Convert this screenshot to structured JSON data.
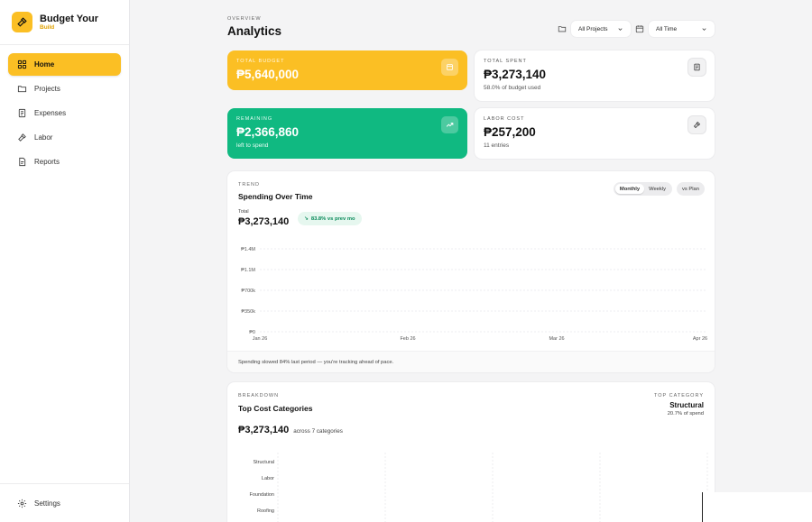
{
  "brand": {
    "title": "Budget Your",
    "subtitle": "Build",
    "accent": "#fbbf24"
  },
  "sidebar": {
    "items": [
      {
        "label": "Home",
        "icon": "grid-icon",
        "active": true
      },
      {
        "label": "Projects",
        "icon": "folder-icon",
        "active": false
      },
      {
        "label": "Expenses",
        "icon": "receipt-icon",
        "active": false
      },
      {
        "label": "Labor",
        "icon": "hammer-icon",
        "active": false
      },
      {
        "label": "Reports",
        "icon": "document-icon",
        "active": false
      }
    ],
    "footer": {
      "label": "Settings",
      "icon": "gear-icon"
    }
  },
  "header": {
    "eyebrow": "OVERVIEW",
    "title": "Analytics",
    "project_filter": "All Projects",
    "time_filter": "All Time"
  },
  "stats": {
    "total_budget": {
      "label": "TOTAL BUDGET",
      "value": "₱5,640,000",
      "color": "#fbbf24"
    },
    "total_spent": {
      "label": "TOTAL SPENT",
      "value": "₱3,273,140",
      "sub": "58.0% of budget used"
    },
    "remaining": {
      "label": "REMAINING",
      "value": "₱2,366,860",
      "sub": "left to spend",
      "color": "#10b981"
    },
    "labor_cost": {
      "label": "LABOR COST",
      "value": "₱257,200",
      "sub": "11 entries"
    }
  },
  "trend": {
    "eyebrow": "TREND",
    "title": "Spending Over Time",
    "toggle": {
      "monthly": "Monthly",
      "weekly": "Weekly",
      "selected": "Monthly"
    },
    "vs_plan": "vs Plan",
    "total_label": "Total",
    "total_value": "₱3,273,140",
    "change": "83.8% vs prev mo",
    "footer": "Spending slowed 84% last period — you're tracking ahead of pace."
  },
  "breakdown": {
    "eyebrow": "BREAKDOWN",
    "title": "Top Cost Categories",
    "top_label": "TOP CATEGORY",
    "top_name": "Structural",
    "top_pct": "20.7% of spend",
    "total_value": "₱3,273,140",
    "total_sub": "across 7 categories"
  },
  "chart_data": [
    {
      "type": "line",
      "title": "Spending Over Time",
      "x": [
        "Jan 26",
        "Feb 26",
        "Mar 26",
        "Apr 26"
      ],
      "y_ticks": [
        "₱0",
        "₱350k",
        "₱700k",
        "₱1.1M",
        "₱1.4M"
      ],
      "ylim": [
        0,
        1400000
      ],
      "grid": true,
      "series": []
    },
    {
      "type": "bar",
      "title": "Top Cost Categories",
      "categories": [
        "Structural",
        "Labor",
        "Foundation",
        "Roofing"
      ],
      "grid": true,
      "values": []
    }
  ]
}
